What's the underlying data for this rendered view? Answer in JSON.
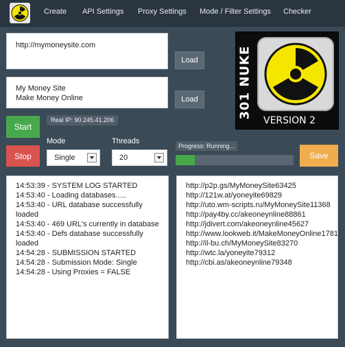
{
  "app": {
    "logo_icon": "radiation-icon"
  },
  "menu": {
    "items": [
      {
        "label": "Create"
      },
      {
        "label": "API Settings"
      },
      {
        "label": "Proxy Settings"
      },
      {
        "label": "Mode / Filter Settings"
      },
      {
        "label": "Checker"
      }
    ]
  },
  "inputs": {
    "url_box": {
      "value": "http://mymoneysite.com"
    },
    "keywords_box": {
      "lines": [
        "My Money Site",
        "Make Money Online"
      ]
    }
  },
  "buttons": {
    "load_1": "Load",
    "load_2": "Load",
    "start": "Start",
    "stop": "Stop",
    "save": "Save"
  },
  "status": {
    "real_ip": "Real IP: 90.245.41.206"
  },
  "controls": {
    "mode_label": "Mode",
    "mode_value": "Single",
    "threads_label": "Threads",
    "threads_value": "20"
  },
  "progress": {
    "label": "Progress: Running...",
    "fraction": 0.16
  },
  "brand": {
    "title": "301 NUKE",
    "version": "VERSION 2"
  },
  "log": {
    "lines": [
      "14:53:39 - SYSTEM LOG STARTED",
      "14:53:40 - Loading databases.....",
      "14:53:40 - URL database successfully",
      "loaded",
      "14:53:40 - 469 URL's currently in database",
      "14:53:40 - Defs database successfully",
      "loaded",
      "14:54:28 - SUBMISSION STARTED",
      "14:54:28 - Submission Mode: Single",
      "14:54:28 - Using Proxies = FALSE"
    ]
  },
  "results": {
    "urls": [
      "http://p2p.gs/MyMoneySite63425",
      "http://121w.at/yoneyite69829",
      "http://uto.wm-scripts.ru/MyMoneySite11368",
      "http://pay4by.cc/akeoneynline88861",
      "http://jdivert.com/akeoneynline45627",
      "http://www.lookweb.it/MakeMoneyOnline1781",
      "http://il-bu.ch/MyMoneySite83270",
      "http://wtc.la/yoneyite79312",
      "http://cbi.as/akeoneynline79348"
    ]
  },
  "colors": {
    "background": "#3b4a57",
    "start": "#48a94c",
    "stop": "#d9534f",
    "save": "#f0ad4e",
    "radiation_yellow": "#f5e600"
  }
}
